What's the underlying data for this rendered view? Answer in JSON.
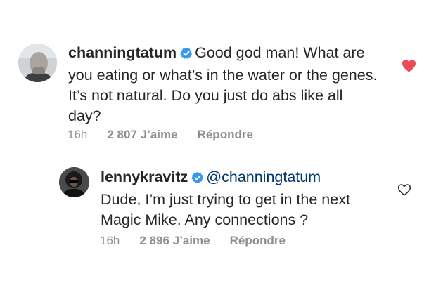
{
  "comments": [
    {
      "username": "channingtatum",
      "text": "Good god man! What are you eating or what’s in the water or the genes. It’s not natural. Do you just do abs like all day?",
      "time": "16h",
      "likes": "2 807 J’aime",
      "reply_label": "Répondre",
      "liked": true
    },
    {
      "username": "lennykravitz",
      "mention": "@channingtatum",
      "text": "Dude, I’m just trying to get in the next Magic Mike. Any connections ?",
      "time": "16h",
      "likes": "2 896 J’aime",
      "reply_label": "Répondre",
      "liked": false
    }
  ],
  "colors": {
    "text": "#262626",
    "meta": "#8e8e8e",
    "mention": "#00376b",
    "verified": "#3897f0",
    "like_red": "#ed4956"
  },
  "icons": {
    "verified": "verified-badge-icon",
    "like_filled": "heart-filled-icon",
    "like_outline": "heart-outline-icon"
  }
}
